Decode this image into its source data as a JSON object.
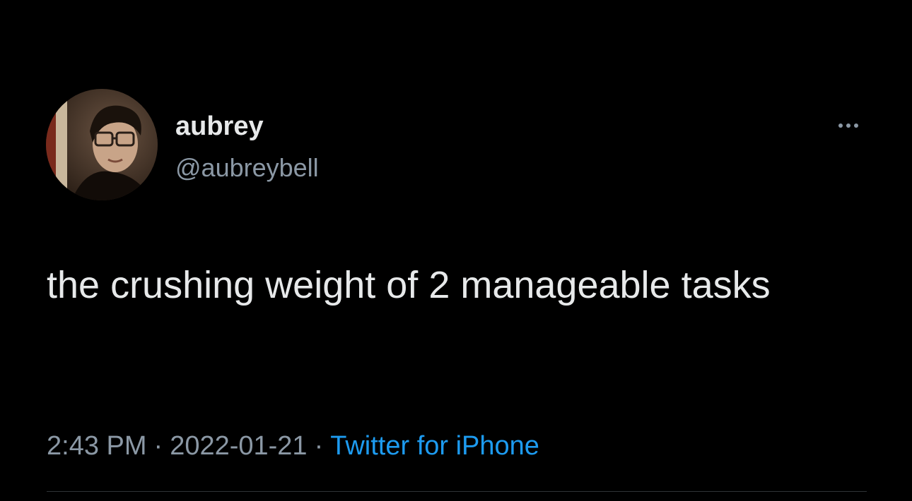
{
  "tweet": {
    "author": {
      "display_name": "aubrey",
      "handle": "@aubreybell",
      "avatar_icon": "profile-photo"
    },
    "more_icon": "more-options-icon",
    "text": "the crushing weight of 2 manageable tasks",
    "meta": {
      "time": "2:43 PM",
      "separator": "·",
      "date": "2022-01-21",
      "source": "Twitter for iPhone"
    }
  },
  "colors": {
    "background": "#000000",
    "primary_text": "#e7e9ea",
    "secondary_text": "#8b98a5",
    "link": "#1d9bf0",
    "divider": "#2f3336"
  }
}
